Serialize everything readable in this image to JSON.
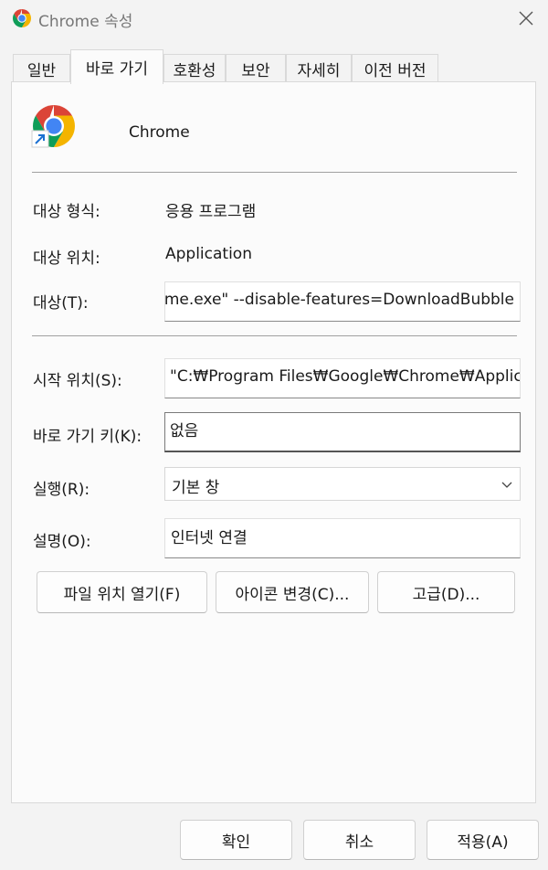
{
  "window": {
    "title": "Chrome 속성",
    "close_icon": "close-icon"
  },
  "tabs": [
    {
      "label": "일반",
      "active": false
    },
    {
      "label": "바로 가기",
      "active": true
    },
    {
      "label": "호환성",
      "active": false
    },
    {
      "label": "보안",
      "active": false
    },
    {
      "label": "자세히",
      "active": false
    },
    {
      "label": "이전 버전",
      "active": false
    }
  ],
  "shortcut": {
    "name": "Chrome",
    "target_type_label": "대상 형식:",
    "target_type_value": "응용 프로그램",
    "target_location_label": "대상 위치:",
    "target_location_value": "Application",
    "target_label": "대상(T):",
    "target_value": "rome.exe\" --disable-features=DownloadBubble",
    "start_in_label": "시작 위치(S):",
    "start_in_value": "\"C:₩Program Files₩Google₩Chrome₩Applicati",
    "hotkey_label": "바로 가기 키(K):",
    "hotkey_value": "없음",
    "run_label": "실행(R):",
    "run_value": "기본 창",
    "comment_label": "설명(O):",
    "comment_value": "인터넷 연결"
  },
  "buttons": {
    "open_location": "파일 위치 열기(F)",
    "change_icon": "아이콘 변경(C)...",
    "advanced": "고급(D)...",
    "ok": "확인",
    "cancel": "취소",
    "apply": "적용(A)"
  },
  "colors": {
    "chrome_red": "#db4437",
    "chrome_yellow": "#f4b400",
    "chrome_green": "#0f9d58",
    "chrome_blue": "#4285f4"
  }
}
